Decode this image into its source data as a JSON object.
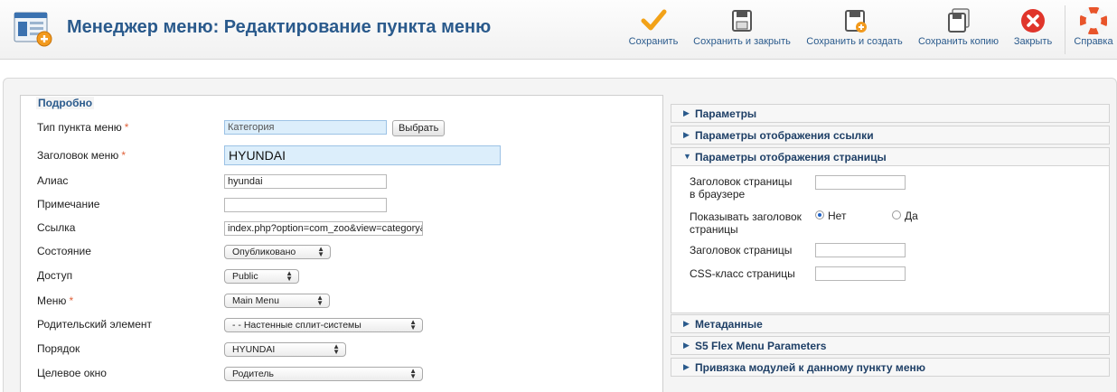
{
  "header": {
    "title": "Менеджер меню: Редактирование пункта меню",
    "toolbar": {
      "save": "Сохранить",
      "save_close": "Сохранить и закрыть",
      "save_new": "Сохранить и создать",
      "save_copy": "Сохранить копию",
      "close": "Закрыть",
      "help": "Справка"
    }
  },
  "details": {
    "legend": "Подробно",
    "type_label": "Тип пункта меню",
    "type_value": "Категория",
    "select_button": "Выбрать",
    "title_label": "Заголовок меню",
    "title_value": "HYUNDAI",
    "alias_label": "Алиас",
    "alias_value": "hyundai",
    "note_label": "Примечание",
    "note_value": "",
    "link_label": "Ссылка",
    "link_value": "index.php?option=com_zoo&view=category&",
    "status_label": "Состояние",
    "status_value": "Опубликовано",
    "access_label": "Доступ",
    "access_value": "Public",
    "menu_label": "Меню",
    "menu_value": "Main Menu",
    "parent_label": "Родительский элемент",
    "parent_value": "- - Настенные сплит-системы",
    "order_label": "Порядок",
    "order_value": "HYUNDAI",
    "target_label": "Целевое окно",
    "target_value": "Родитель",
    "required_mark": "*"
  },
  "params": {
    "panels": {
      "options": "Параметры",
      "link_display": "Параметры отображения ссылки",
      "page_display": "Параметры отображения страницы",
      "metadata": "Метаданные",
      "s5flex": "S5 Flex Menu Parameters",
      "modules": "Привязка модулей к данному пункту меню"
    },
    "browser_title_label_1": "Заголовок страницы",
    "browser_title_label_2": "в браузере",
    "browser_title_value": "",
    "show_title_label_1": "Показывать заголовок",
    "show_title_label_2": "страницы",
    "show_title_no": "Нет",
    "show_title_yes": "Да",
    "show_title_selected": "Нет",
    "page_heading_label": "Заголовок страницы",
    "page_heading_value": "",
    "css_label": "CSS-класс страницы",
    "css_value": ""
  },
  "colors": {
    "title": "#2a5a8c",
    "required": "#e0623b",
    "highlight_field": "#dceefb"
  },
  "icons": [
    "menu-manager-icon",
    "checkmark-icon",
    "save-icon",
    "save-new-icon",
    "save-copy-icon",
    "close-icon",
    "help-icon"
  ]
}
